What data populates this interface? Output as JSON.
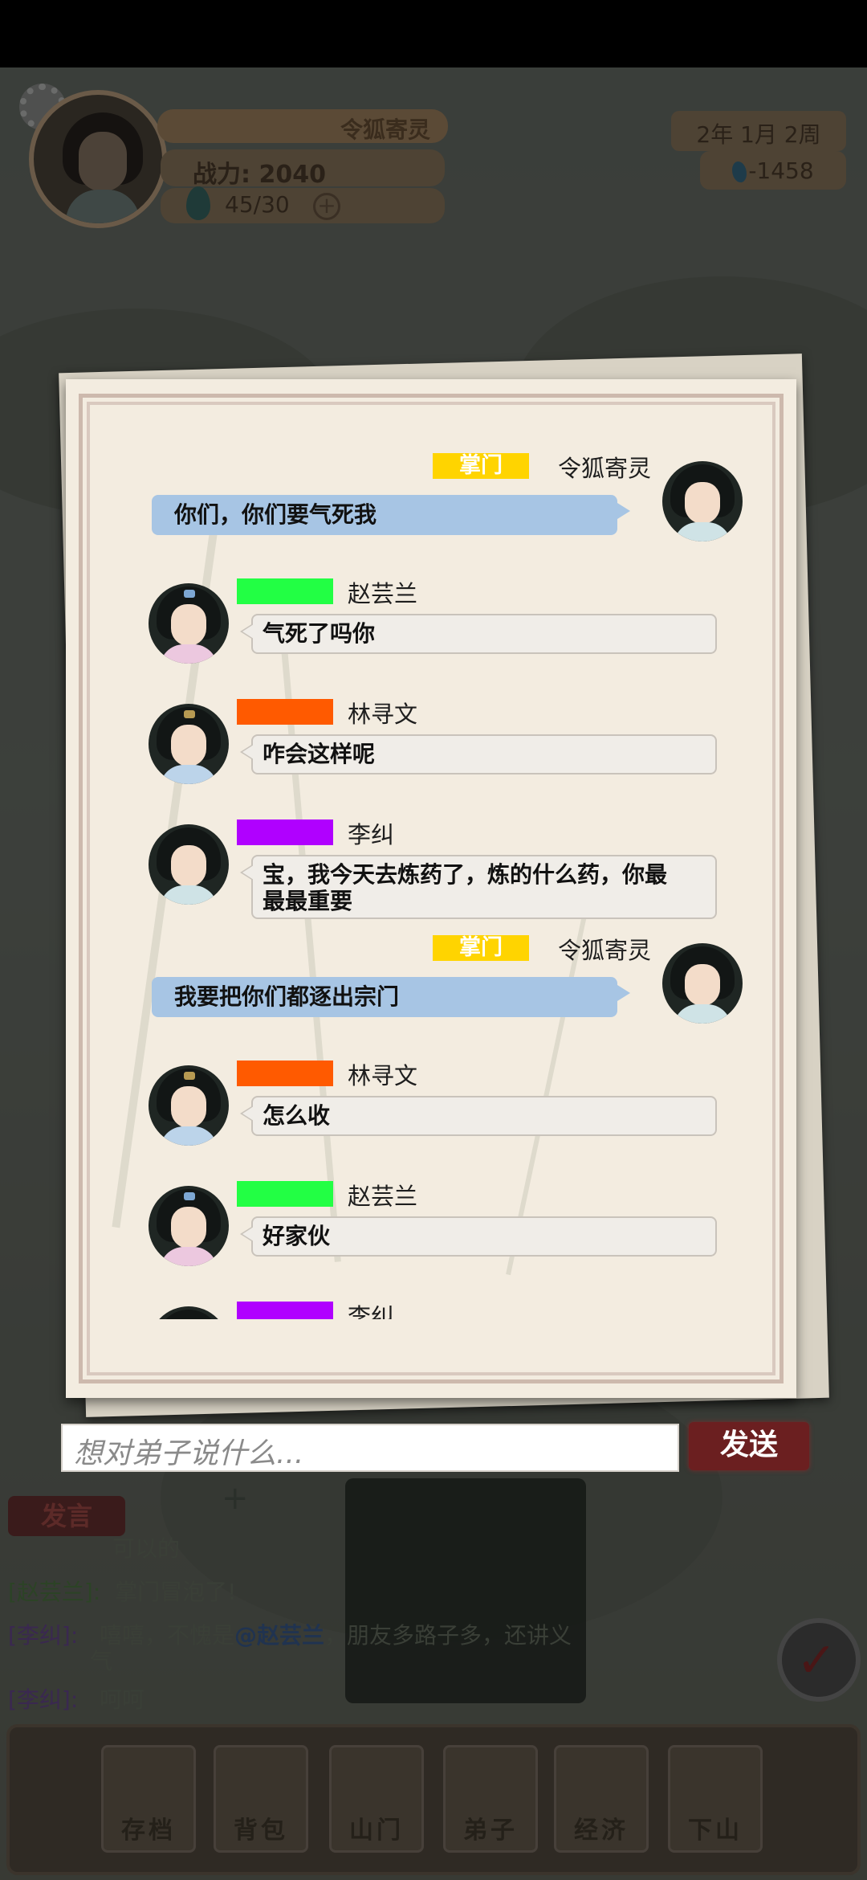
{
  "hud": {
    "player_name": "令狐寄灵",
    "power_label": "战力:",
    "power_value": "2040",
    "energy": "45/30",
    "energy_add": "+",
    "date": "2年   1月  2周",
    "coins": "-1458"
  },
  "chat": {
    "messages": [
      {
        "side": "right",
        "rank": "掌门",
        "rank_color": "#FFD400",
        "name": "令狐寄灵",
        "text": "你们，你们要气死我"
      },
      {
        "side": "left",
        "rank": "",
        "rank_color": "#22FF44",
        "name": "赵芸兰",
        "text": "气死了吗你"
      },
      {
        "side": "left",
        "rank": "",
        "rank_color": "#FF5A00",
        "name": "林寻文",
        "text": "咋会这样呢"
      },
      {
        "side": "left",
        "rank": "",
        "rank_color": "#B000FF",
        "name": "李纠",
        "text_line1": "宝，我今天去炼药了，炼的什么药，你最",
        "text_line2": "最最重要"
      },
      {
        "side": "right",
        "rank": "掌门",
        "rank_color": "#FFD400",
        "name": "令狐寄灵",
        "text": "我要把你们都逐出宗门"
      },
      {
        "side": "left",
        "rank": "",
        "rank_color": "#FF5A00",
        "name": "林寻文",
        "text": "怎么收"
      },
      {
        "side": "left",
        "rank": "",
        "rank_color": "#22FF44",
        "name": "赵芸兰",
        "text": "好家伙"
      },
      {
        "side": "left",
        "rank": "",
        "rank_color": "#B000FF",
        "name": "李纠",
        "text": ""
      }
    ]
  },
  "input": {
    "placeholder": "想对弟子说什么...",
    "send_label": "发送"
  },
  "world": {
    "speak_tab": "发言",
    "line0": {
      "who": "",
      "text": "可以的"
    },
    "line1": {
      "who": "[赵芸兰]:",
      "text": "掌门冒泡了!"
    },
    "line2": {
      "who": "[李纠]:",
      "text_a": "嘻嘻，不愧是",
      "mention": "@赵芸兰",
      "text_b": "，朋友多路子多，还讲义",
      "text_c": "气"
    },
    "line3": {
      "who": "[李纠]:",
      "text": "呵呵"
    }
  },
  "dock": {
    "items": [
      "存档",
      "背包",
      "山门",
      "弟子",
      "经济",
      "下山"
    ]
  }
}
